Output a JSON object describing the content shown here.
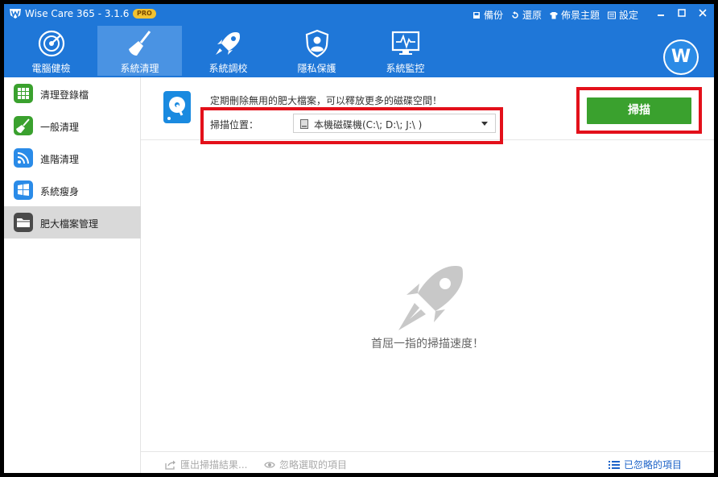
{
  "app": {
    "title": "Wise Care 365 - 3.1.6",
    "badge": "PRO",
    "accent_color": "#1f77d8"
  },
  "title_actions": [
    {
      "label": "備份",
      "icon": "backup-icon"
    },
    {
      "label": "還原",
      "icon": "restore-icon"
    },
    {
      "label": "佈景主題",
      "icon": "tshirt-icon"
    },
    {
      "label": "設定",
      "icon": "settings-icon"
    }
  ],
  "window_controls": [
    "minimize-icon",
    "maximize-icon",
    "close-icon"
  ],
  "nav": [
    {
      "label": "電腦健檢",
      "icon": "radar-icon"
    },
    {
      "label": "系統清理",
      "icon": "broom-icon",
      "active": true
    },
    {
      "label": "系統調校",
      "icon": "rocket-icon"
    },
    {
      "label": "隱私保護",
      "icon": "shield-user-icon"
    },
    {
      "label": "系統監控",
      "icon": "monitor-pulse-icon"
    }
  ],
  "avatar": {
    "letter": "W"
  },
  "sidebar": {
    "items": [
      {
        "label": "清理登錄檔",
        "icon": "registry-grid-icon",
        "color": "#3aa12e"
      },
      {
        "label": "一般清理",
        "icon": "broom-icon",
        "color": "#3aa12e"
      },
      {
        "label": "進階清理",
        "icon": "advanced-clean-icon",
        "color": "#2a8be8"
      },
      {
        "label": "系統瘦身",
        "icon": "windows-icon",
        "color": "#2a8be8"
      },
      {
        "label": "肥大檔案管理",
        "icon": "folder-icon",
        "color": "#4a4a4a",
        "active": true
      }
    ]
  },
  "main": {
    "description": "定期刪除無用的肥大檔案，可以釋放更多的磁碟空間！",
    "location_label": "掃描位置：",
    "location_value": "本機磁碟機(C:\\; D:\\; J:\\ )",
    "scan_button": "掃描",
    "empty_text": "首屈一指的掃描速度！"
  },
  "footer": {
    "export": "匯出掃描結果...",
    "ignore": "忽略選取的項目",
    "ignored_items": "已忽略的項目"
  }
}
